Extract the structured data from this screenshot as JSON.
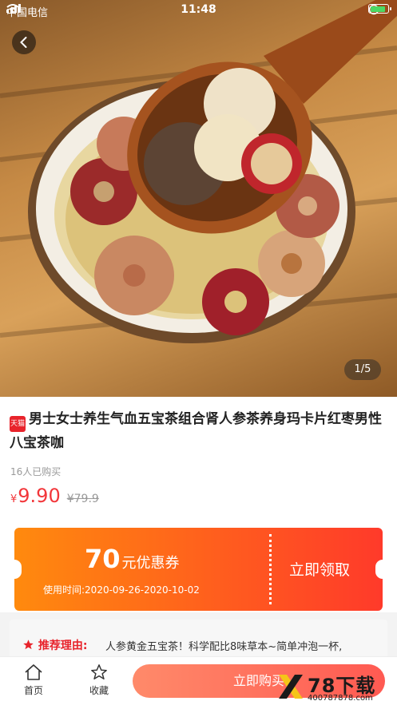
{
  "status_bar": {
    "carrier": "中国电信",
    "time": "11:48"
  },
  "hero": {
    "pager": "1/5"
  },
  "product": {
    "badge": "天猫",
    "title": "男士女士养生气血五宝茶组合肾人参茶养身玛卡片红枣男性八宝茶咖",
    "sold": "16人已购买",
    "price_currency": "¥",
    "price": "9.90",
    "original_price": "¥79.9"
  },
  "coupon": {
    "amount": "70",
    "unit": "元优惠券",
    "period": "使用时间:2020-09-26-2020-10-02",
    "claim": "立即领取"
  },
  "reason": {
    "label": "推荐理由:",
    "text": "人参黄金五宝茶！科学配比8味草本~简单冲泡一杯,"
  },
  "bottom_bar": {
    "home": "首页",
    "favorite": "收藏",
    "buy": "立即购买"
  },
  "watermark": {
    "big": "78下载",
    "small": "400787878.com"
  },
  "colors": {
    "accent": "#f2363a",
    "coupon_start": "#ff8a0e",
    "coupon_end": "#ff3a2a",
    "buy_start": "#ff8a6a",
    "buy_end": "#ff5a52"
  }
}
